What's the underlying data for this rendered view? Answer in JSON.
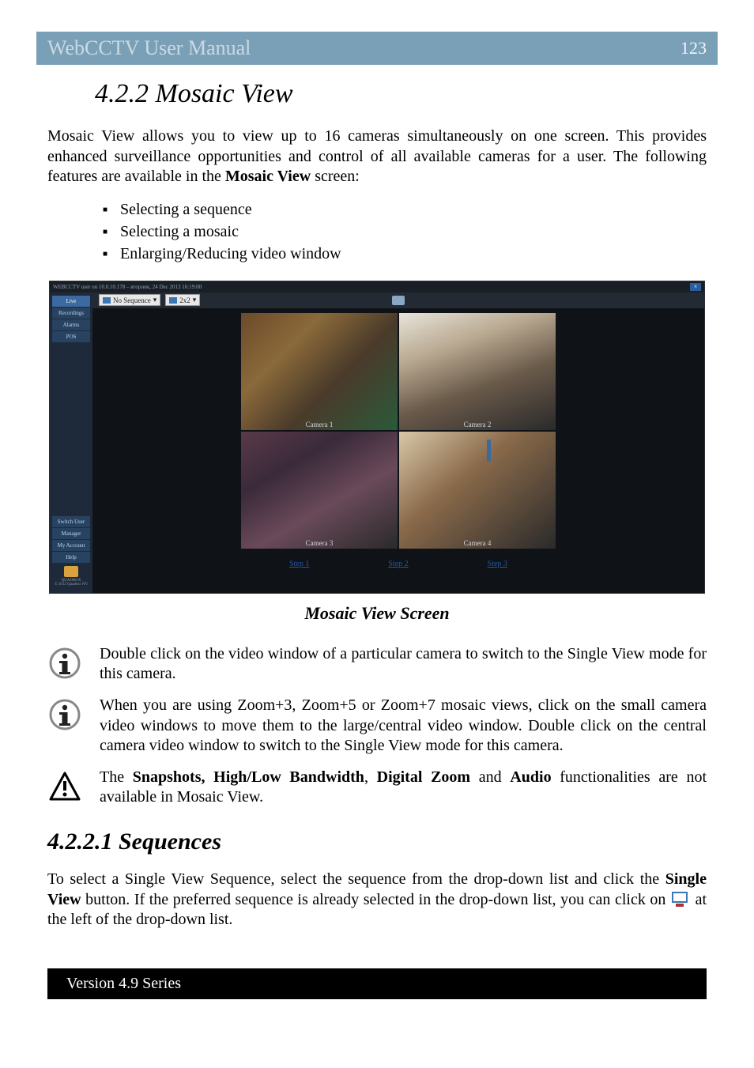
{
  "header": {
    "title": "WebCCTV User Manual",
    "page": "123"
  },
  "section": {
    "number": "4.2.2",
    "title": "Mosaic View"
  },
  "intro": {
    "p1_a": "Mosaic View allows you to view up to 16 cameras simultaneously on one screen. This provides enhanced surveillance opportunities and control of all available cameras for a user. The following features are available in the ",
    "p1_bold": "Mosaic View",
    "p1_b": " screen:"
  },
  "features": [
    "Selecting a sequence",
    "Selecting a mosaic",
    "Enlarging/Reducing video window"
  ],
  "screenshot": {
    "close": "×",
    "status": "WEBCCTV user on 10.0.10.178 – вторник, 24 Dec 2013 16:19:00",
    "dropdown1": "No Sequence",
    "dropdown2": "2x2",
    "sidebar_top": [
      "Live",
      "Recordings",
      "Alarms",
      "POS"
    ],
    "sidebar_bottom": [
      "Switch User",
      "Manager",
      "My Account",
      "Help"
    ],
    "logo_text": "QUADROX",
    "copyright": "© 2012 Quadrox NV",
    "cams": [
      "Camera 1",
      "Camera 2",
      "Camera 3",
      "Camera 4"
    ],
    "steps": [
      "Step 1",
      "Step 2",
      "Step 3"
    ]
  },
  "caption": "Mosaic View Screen",
  "notes": {
    "n1": "Double click on the video window of a particular camera to switch to the Single View mode for this camera.",
    "n2": "When you are using Zoom+3, Zoom+5 or Zoom+7 mosaic views, click on the small camera video windows to move them to the large/central video window. Double click on the central camera video window to switch to the Single View mode for this camera.",
    "n3_a": "The ",
    "n3_b1": "Snapshots, High/Low Bandwidth",
    "n3_mid": ", ",
    "n3_b2": "Digital Zoom",
    "n3_and": " and ",
    "n3_b3": "Audio",
    "n3_c": " functionalities are not available in Mosaic View."
  },
  "subsection": {
    "number": "4.2.2.1",
    "title": "Sequences"
  },
  "seq": {
    "p1_a": "To select a Single View Sequence, select the sequence from the drop-down list and click the ",
    "p1_bold": "Single View",
    "p1_b": " button. If the preferred sequence is already selected in the drop-down list, you can click on ",
    "p1_c": " at the left of the drop-down list."
  },
  "footer": "Version 4.9 Series"
}
